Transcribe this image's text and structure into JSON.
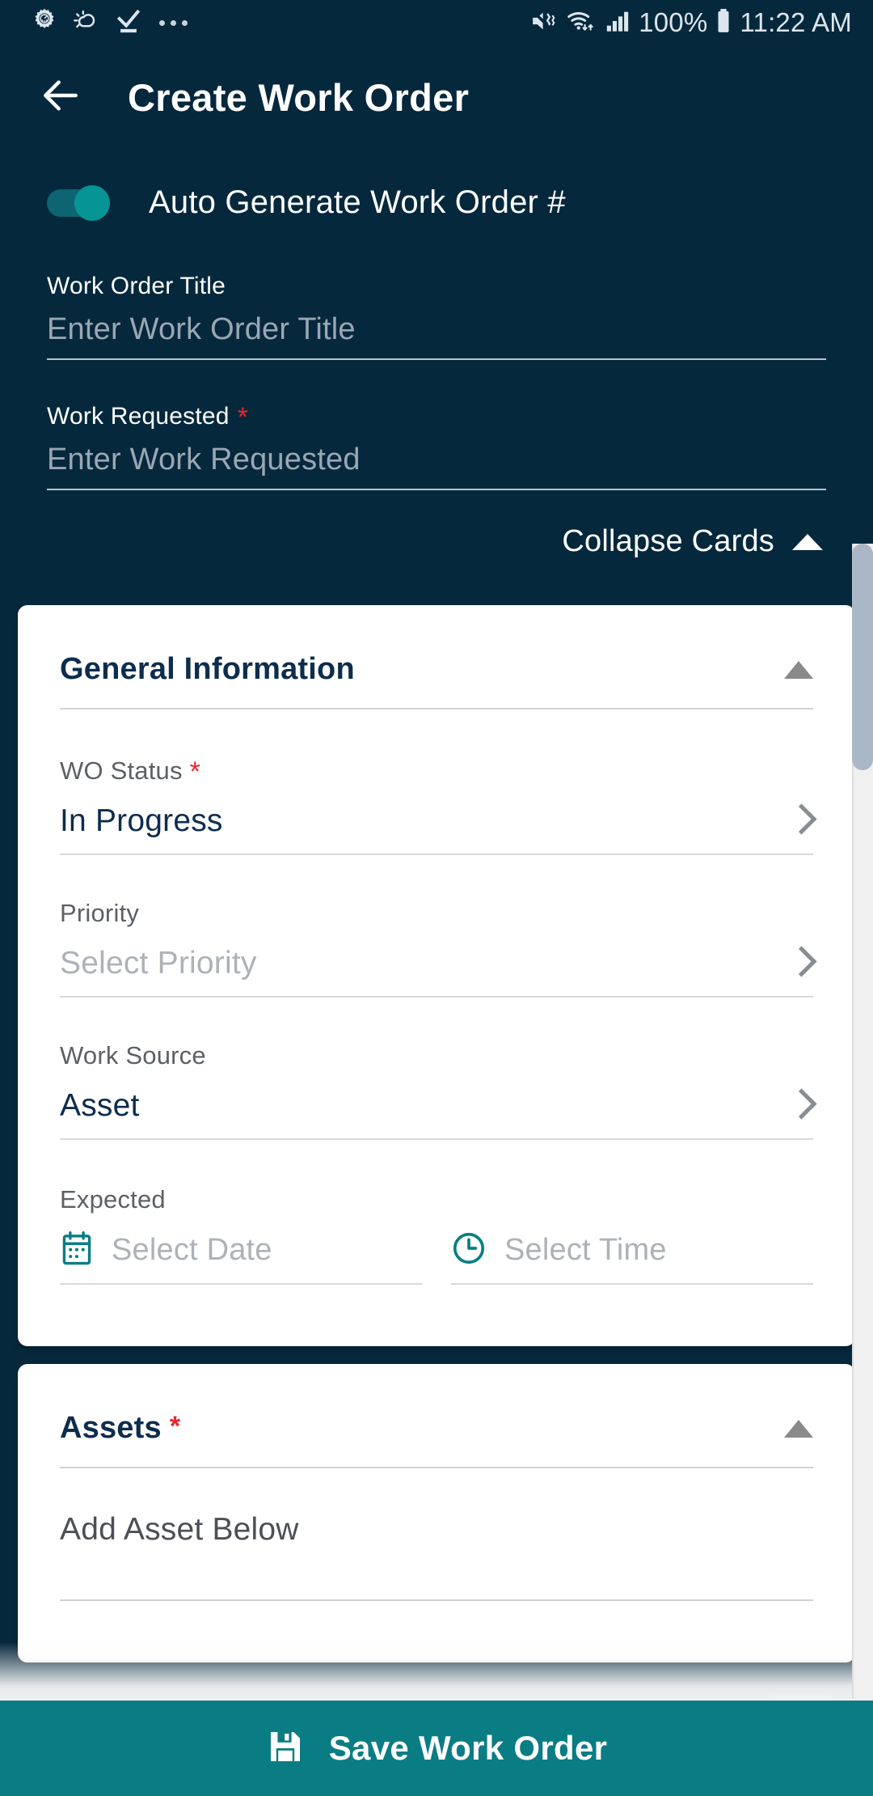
{
  "status_bar": {
    "left_icons": [
      "settings-gauge-icon",
      "weather-icon",
      "download-complete-icon",
      "more-icons-overflow"
    ],
    "mute_icon": "volume-mute-vibrate-icon",
    "wifi_icon": "wifi-icon",
    "signal_icon": "cellular-signal-icon",
    "battery_percent": "100%",
    "battery_icon": "battery-full-icon",
    "time": "11:22 AM"
  },
  "app_bar": {
    "back_icon": "back-arrow-icon",
    "title": "Create Work Order"
  },
  "form": {
    "auto_generate": {
      "label": "Auto Generate Work Order #",
      "enabled": true
    },
    "work_order_title": {
      "label": "Work Order Title",
      "placeholder": "Enter Work Order Title",
      "value": ""
    },
    "work_requested": {
      "label": "Work Requested",
      "required": "*",
      "placeholder": "Enter Work Requested",
      "value": ""
    },
    "collapse_cards": {
      "label": "Collapse Cards",
      "icon": "triangle-up-icon"
    }
  },
  "cards": {
    "general_information": {
      "title": "General Information",
      "collapse_icon": "triangle-up-icon",
      "fields": {
        "wo_status": {
          "label": "WO Status",
          "required": "*",
          "value": "In Progress",
          "chevron": "chevron-right-icon"
        },
        "priority": {
          "label": "Priority",
          "placeholder": "Select Priority",
          "value": "",
          "chevron": "chevron-right-icon"
        },
        "work_source": {
          "label": "Work Source",
          "value": "Asset",
          "chevron": "chevron-right-icon"
        },
        "expected": {
          "label": "Expected",
          "date_icon": "calendar-icon",
          "date_placeholder": "Select Date",
          "date_value": "",
          "time_icon": "clock-icon",
          "time_placeholder": "Select Time",
          "time_value": ""
        }
      }
    },
    "assets": {
      "title": "Assets",
      "required": "*",
      "collapse_icon": "triangle-up-icon",
      "add_text": "Add Asset Below"
    }
  },
  "bottom_bar": {
    "save_icon": "save-floppy-icon",
    "save_label": "Save Work Order"
  },
  "colors": {
    "background_navy": "#06283d",
    "accent_teal": "#0a7d84",
    "card_white": "#ffffff",
    "required_red": "#e8252a",
    "title_navy": "#0d2d4e",
    "placeholder_grey": "#adb2b7",
    "scrollbar_thumb": "#a9b7c6"
  }
}
